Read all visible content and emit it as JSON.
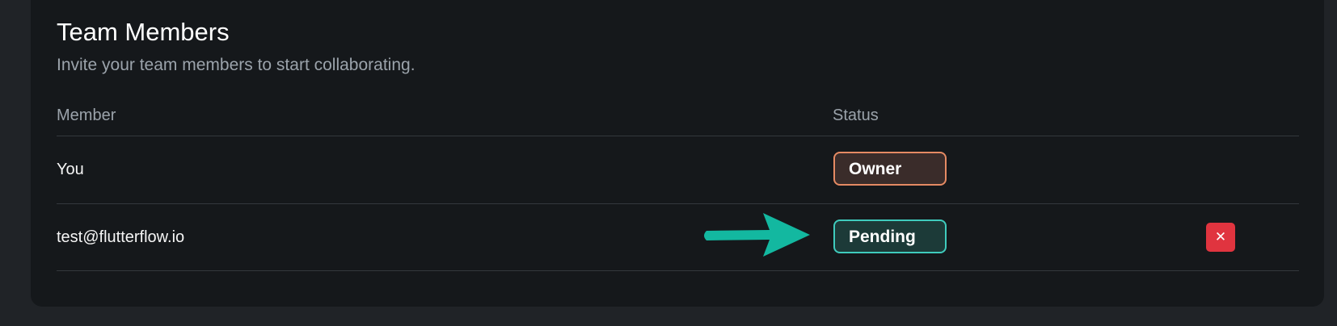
{
  "card": {
    "title": "Team Members",
    "subtitle": "Invite your team members to start collaborating."
  },
  "table": {
    "columns": [
      "Member",
      "Status"
    ],
    "rows": [
      {
        "member": "You",
        "status": "Owner",
        "status_color": "#e58a63"
      },
      {
        "member": "test@flutterflow.io",
        "status": "Pending",
        "status_color": "#3fcbbd",
        "action_icon": "close-icon",
        "action_color": "#e0343f"
      }
    ]
  },
  "remove_button": {
    "glyph": "✕"
  },
  "annotation": {
    "icon": "arrow-right-icon",
    "color": "#13b8a0"
  }
}
